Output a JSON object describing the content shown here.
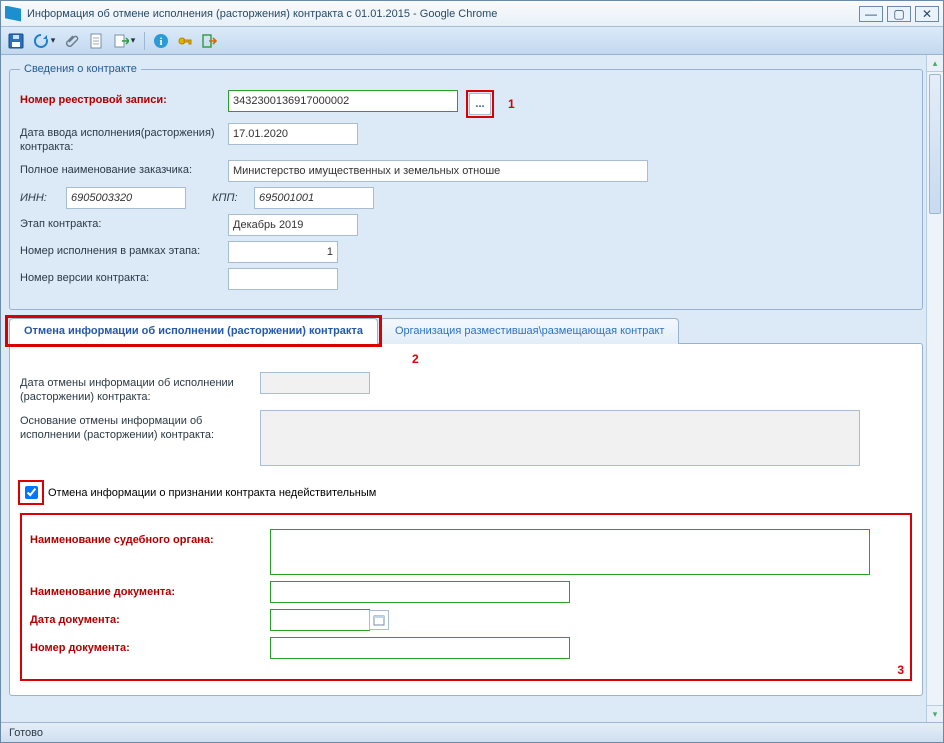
{
  "window": {
    "title": "Информация об отмене исполнения (расторжения) контракта с 01.01.2015 - Google Chrome"
  },
  "toolbar": {
    "icons": [
      "save",
      "refresh",
      "attach",
      "doc",
      "export",
      "help",
      "key",
      "exit"
    ]
  },
  "fieldset": {
    "legend": "Сведения о контракте",
    "registry_label": "Номер реестровой записи:",
    "registry_value": "3432300136917000002",
    "input_date_label": "Дата ввода исполнения(расторжения) контракта:",
    "input_date_value": "17.01.2020",
    "customer_label": "Полное наименование заказчика:",
    "customer_value": "Министерство имущественных и земельных отноше",
    "inn_label": "ИНН:",
    "inn_value": "6905003320",
    "kpp_label": "КПП:",
    "kpp_value": "695001001",
    "stage_label": "Этап контракта:",
    "stage_value": "Декабрь 2019",
    "exec_num_label": "Номер исполнения в рамках этапа:",
    "exec_num_value": "1",
    "version_label": "Номер версии контракта:",
    "version_value": ""
  },
  "annotations": {
    "a1": "1",
    "a2": "2",
    "a3": "3"
  },
  "tabs": {
    "tab1": "Отмена информации об исполнении (расторжении) контракта",
    "tab2": "Организация разместившая\\размещающая контракт"
  },
  "panel": {
    "cancel_date_label": "Дата отмены информации об исполнении (расторжении) контракта:",
    "cancel_date_value": "",
    "cancel_reason_label": "Основание отмены информации об исполнении (расторжении) контракта:",
    "cancel_reason_value": "",
    "checkbox_label": "Отмена информации о признании контракта недействительным",
    "court_label": "Наименование судебного органа:",
    "court_value": "",
    "doc_name_label": "Наименование документа:",
    "doc_name_value": "",
    "doc_date_label": "Дата документа:",
    "doc_date_value": "",
    "doc_num_label": "Номер документа:",
    "doc_num_value": ""
  },
  "status": {
    "text": "Готово"
  }
}
